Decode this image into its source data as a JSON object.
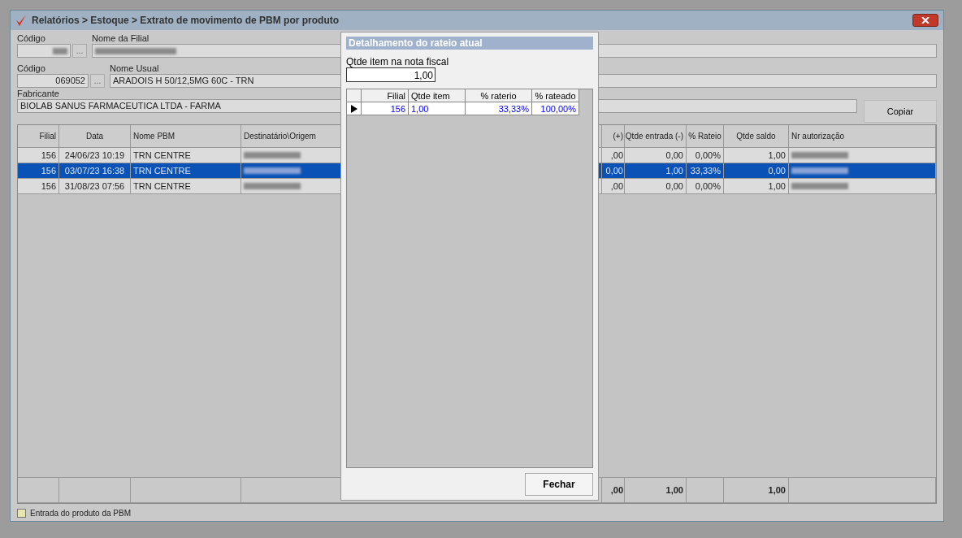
{
  "window": {
    "title": "Relatórios > Estoque > Extrato de movimento de PBM por produto"
  },
  "filial": {
    "code_label": "Código",
    "name_label": "Nome da Filial"
  },
  "produto": {
    "code_label": "Código",
    "code": "069052",
    "name_label": "Nome Usual",
    "name": "ARADOIS H  50/12,5MG 60C - TRN"
  },
  "fabricante": {
    "label": "Fabricante",
    "value": "BIOLAB SANUS FARMACEUTICA LTDA - FARMA"
  },
  "copy_button": "Copiar",
  "table": {
    "columns": [
      "Filial",
      "Data",
      "Nome PBM",
      "Destinatário\\Origem",
      "(+)",
      "Qtde entrada (-)",
      "% Rateio",
      "Qtde saldo",
      "Nr autorização"
    ],
    "rows": [
      {
        "selected": false,
        "cells": [
          "156",
          "24/06/23 10:19",
          "TRN CENTRE",
          "",
          ",00",
          "0,00",
          "0,00%",
          "1,00",
          ""
        ]
      },
      {
        "selected": true,
        "cells": [
          "156",
          "03/07/23 16:38",
          "TRN CENTRE",
          "",
          "0,00",
          "1,00",
          "33,33%",
          "0,00",
          ""
        ]
      },
      {
        "selected": false,
        "cells": [
          "156",
          "31/08/23 07:56",
          "TRN CENTRE",
          "",
          ",00",
          "0,00",
          "0,00%",
          "1,00",
          ""
        ]
      }
    ],
    "totals": {
      "qtde_plus": ",00",
      "qtde_entrada": "1,00",
      "qtde_saldo": "1,00"
    }
  },
  "browse_button": "...",
  "checkbox": {
    "label": "Entrada do produto da PBM",
    "checked": false
  },
  "dialog": {
    "title": "Detalhamento do rateio atual",
    "qty_label": "Qtde item na nota fiscal",
    "qty_value": "1,00",
    "columns": [
      "Filial",
      "Qtde item",
      "% raterio",
      "% rateado"
    ],
    "rows": [
      {
        "cells": [
          "156",
          "1,00",
          "33,33%",
          "100,00%"
        ]
      }
    ],
    "close_button": "Fechar"
  }
}
